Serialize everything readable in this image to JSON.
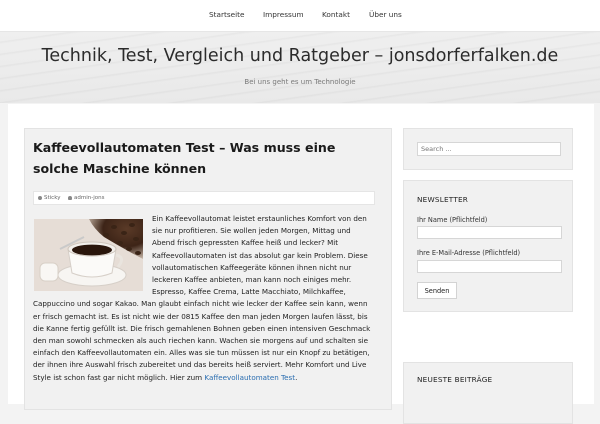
{
  "nav": {
    "items": [
      {
        "label": "Startseite"
      },
      {
        "label": "Impressum"
      },
      {
        "label": "Kontakt"
      },
      {
        "label": "Über uns"
      }
    ]
  },
  "header": {
    "title": "Technik, Test, Vergleich und Ratgeber – jonsdorferfalken.de",
    "description": "Bei uns geht es um Technologie"
  },
  "post": {
    "title": "Kaffeevollautomaten Test – Was muss eine solche Maschine können",
    "meta": {
      "sticky": "Sticky",
      "author": "admin-jons"
    },
    "paragraph": "Ein Kaffeevollautomat leistet erstaunliches Komfort von den sie nur profitieren. Sie wollen jeden Morgen, Mittag und Abend frisch gepressten Kaffee heiß und lecker? Mit Kaffeevollautomaten ist das absolut gar kein Problem. Diese vollautomatischen Kaffeegeräte können ihnen nicht nur leckeren Kaffee anbieten, man kann noch einiges mehr. Espresso, Kaffee Crema, Latte Macchiato, Milchkaffee, Cappuccino und sogar Kakao. Man glaubt einfach nicht wie lecker der Kaffee sein kann, wenn er frisch gemacht ist. Es ist nicht wie der 0815 Kaffee den man jeden Morgen laufen lässt, bis die Kanne fertig gefüllt ist. Die frisch gemahlenen Bohnen geben einen intensiven Geschmack den man sowohl schmecken als auch riechen kann. Wachen sie morgens auf und schalten sie einfach den Kaffeevollautomaten ein. Alles was sie tun müssen ist nur ein Knopf zu betätigen, der ihnen ihre Auswahl frisch zubereitet und das bereits heiß serviert. Mehr Komfort und Live Style ist schon fast gar nicht möglich. Hier zum",
    "link_text": "Kaffeevollautomaten Test",
    "link_suffix": "."
  },
  "sidebar": {
    "search_placeholder": "Search ...",
    "newsletter": {
      "title": "NEWSLETTER",
      "name_label": "Ihr Name (Pflichtfeld)",
      "email_label": "Ihre E-Mail-Adresse (Pflichtfeld)",
      "submit_label": "Senden"
    },
    "recent_title": "NEUESTE BEITRÄGE"
  }
}
